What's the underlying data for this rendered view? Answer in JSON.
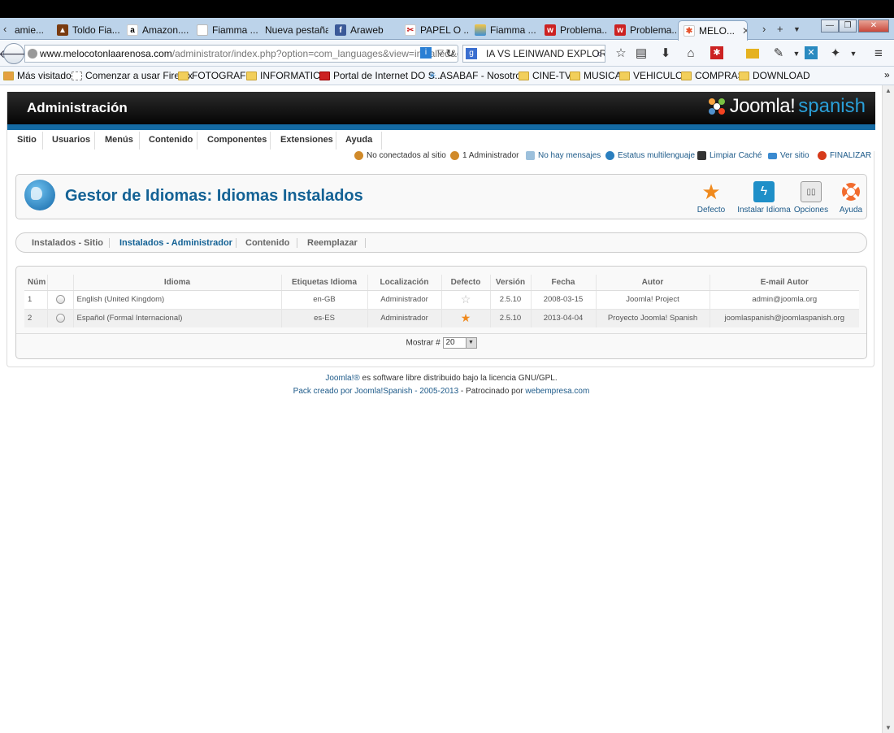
{
  "browser": {
    "tabs": [
      {
        "label": "amie...",
        "icon": "page-icon",
        "color": "#888888"
      },
      {
        "label": "Toldo Fia...",
        "icon": "fire-icon",
        "color": "#d2691e"
      },
      {
        "label": "Amazon....",
        "icon": "amazon-icon",
        "color": "#ff9900"
      },
      {
        "label": "Fiamma ...",
        "icon": "page-icon",
        "color": "#888888"
      },
      {
        "label": "Nueva pestaña",
        "icon": "",
        "color": ""
      },
      {
        "label": "Araweb",
        "icon": "facebook-icon",
        "color": "#3b5998"
      },
      {
        "label": "PAPEL O ...",
        "icon": "scissors-icon",
        "color": "#1d5a89"
      },
      {
        "label": "Fiamma ...",
        "icon": "sunset-icon",
        "color": "#e08a2a"
      },
      {
        "label": "Problema...",
        "icon": "wu-icon",
        "color": "#cc2222"
      },
      {
        "label": "Problema...",
        "icon": "wu-icon",
        "color": "#cc2222"
      },
      {
        "label": "MELO...",
        "icon": "joomla-icon",
        "color": "#e5512a"
      }
    ],
    "url_domain": "www.melocotonlaarenosa.com",
    "url_path": "/administrator/index.php?option=com_languages&view=installed&clie",
    "search_text": "IA VS LEINWAND EXPLORER",
    "bookmarks": [
      "Más visitados",
      "Comenzar a usar Firefox",
      "FOTOGRAFIA",
      "INFORMATICA",
      "Portal de Internet DO S...",
      "ASABAF - Nosotros",
      "CINE-TV",
      "MUSICA",
      "VEHICULOS",
      "COMPRAS",
      "DOWNLOAD"
    ]
  },
  "admin": {
    "header_title": "Administración",
    "logo_word": "Joomla!",
    "logo_suffix": "spanish",
    "menu": [
      "Sitio",
      "Usuarios",
      "Menús",
      "Contenido",
      "Componentes",
      "Extensiones",
      "Ayuda"
    ],
    "status": {
      "not_connected": "No conectados al sitio",
      "admins": "1 Administrador",
      "messages": "No hay mensajes",
      "multilang": "Estatus multilenguaje",
      "cache": "Limpiar Caché",
      "view_site": "Ver sitio",
      "logout": "FINALIZAR"
    },
    "page_title": "Gestor de Idiomas: Idiomas Instalados",
    "toolbar": {
      "default": "Defecto",
      "install": "Instalar Idioma",
      "options": "Opciones",
      "help": "Ayuda"
    },
    "subnav": [
      "Instalados - Sitio",
      "Instalados - Administrador",
      "Contenido",
      "Reemplazar"
    ],
    "table": {
      "headers": [
        "Núm",
        "",
        "Idioma",
        "Etiquetas Idioma",
        "Localización",
        "Defecto",
        "Versión",
        "Fecha",
        "Autor",
        "E-mail Autor"
      ],
      "rows": [
        {
          "num": "1",
          "language": "English (United Kingdom)",
          "tag": "en-GB",
          "location": "Administrador",
          "is_default": false,
          "version": "2.5.10",
          "date": "2008-03-15",
          "author": "Joomla! Project",
          "email": "admin@joomla.org"
        },
        {
          "num": "2",
          "language": "Español (Formal Internacional)",
          "tag": "es-ES",
          "location": "Administrador",
          "is_default": true,
          "version": "2.5.10",
          "date": "2013-04-04",
          "author": "Proyecto Joomla! Spanish",
          "email": "joomlaspanish@joomlaspanish.org"
        }
      ]
    },
    "pager_label": "Mostrar #",
    "pager_value": "20",
    "footer": {
      "line1_link": "Joomla!®",
      "line1_text": " es software libre distribuido bajo la licencia GNU/GPL.",
      "line2_link": "Pack creado por Joomla!Spanish - 2005-2013",
      "line2_text": " - Patrocinado por ",
      "line2_link2": "webempresa.com"
    }
  },
  "colors": {
    "brand_blue": "#146aa3",
    "title_blue": "#146295",
    "star_orange": "#f08a1e"
  }
}
